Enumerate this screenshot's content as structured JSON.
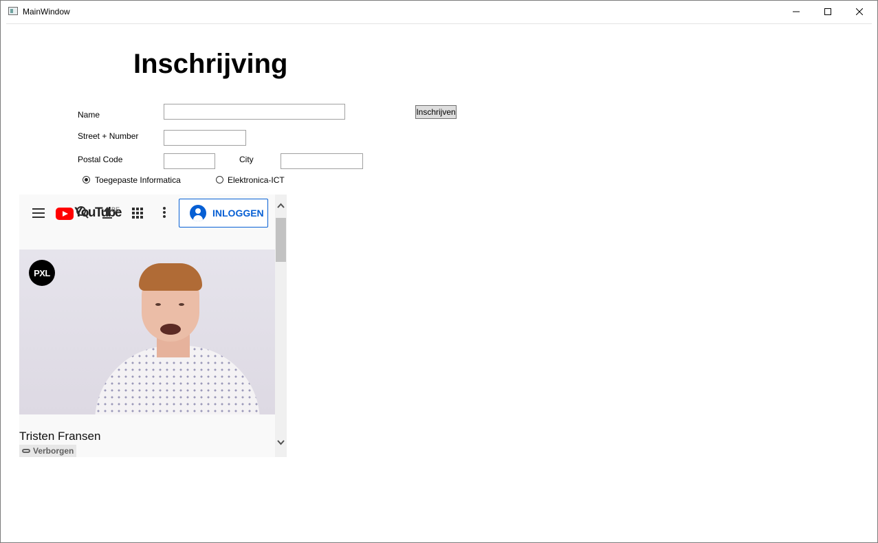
{
  "window": {
    "title": "MainWindow"
  },
  "form": {
    "heading": "Inschrijving",
    "name_label": "Name",
    "name_value": "",
    "street_label": "Street + Number",
    "street_value": "",
    "postal_label": "Postal Code",
    "postal_value": "",
    "city_label": "City",
    "city_value": "",
    "submit_label": "Inschrijven",
    "options": [
      {
        "label": "Toegepaste Informatica",
        "checked": true
      },
      {
        "label": "Elektronica-ICT",
        "checked": false
      }
    ]
  },
  "browser": {
    "logo_text": "YouTube",
    "region": "BE",
    "signin_label": "INLOGGEN",
    "video_channel_logo": "PXL",
    "video_title": "Tristen Fransen",
    "visibility_badge": "Verborgen",
    "brand_color": "#ff0000",
    "accent_color": "#065fd4"
  },
  "icons": [
    "window-app-icon",
    "minimize-icon",
    "maximize-icon",
    "close-icon",
    "menu-icon",
    "youtube-logo-icon",
    "search-icon",
    "upload-icon",
    "apps-icon",
    "more-icon",
    "account-icon",
    "link-icon",
    "scroll-up-icon",
    "scroll-down-icon"
  ]
}
